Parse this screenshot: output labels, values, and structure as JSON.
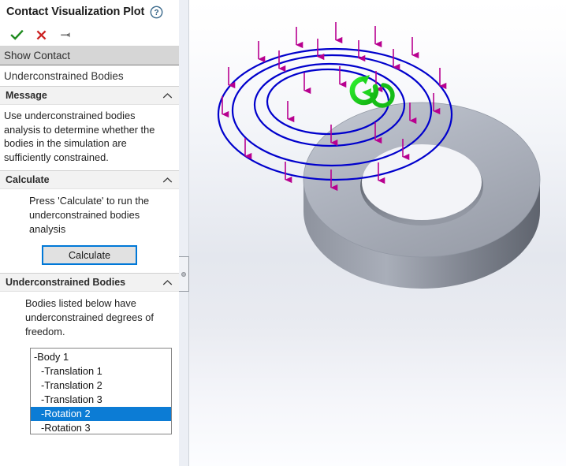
{
  "panel": {
    "title": "Contact Visualization Plot",
    "help_icon": "question-mark-circle-icon",
    "toolbar": {
      "accept_label": "✓",
      "accept_icon": "check-icon",
      "cancel_label": "✕",
      "cancel_icon": "x-icon",
      "pin_label": "⚑",
      "pin_icon": "pushpin-icon"
    },
    "modes": [
      {
        "label": "Show Contact",
        "selected": true
      },
      {
        "label": "Underconstrained Bodies",
        "selected": false
      }
    ],
    "sections": [
      {
        "id": "message",
        "title": "Message",
        "collapse_icon": "chevron-up-icon",
        "text": "Use underconstrained bodies analysis to determine whether the bodies in the simulation are sufficiently constrained."
      },
      {
        "id": "calculate",
        "title": "Calculate",
        "collapse_icon": "chevron-up-icon",
        "hint": "Press 'Calculate' to run the underconstrained bodies analysis",
        "button_label": "Calculate"
      },
      {
        "id": "underconstrained_bodies",
        "title": "Underconstrained Bodies",
        "collapse_icon": "chevron-up-icon",
        "hint": "Bodies listed below have underconstrained degrees of freedom."
      }
    ],
    "dof_list": [
      {
        "label": "-Body 1",
        "level": 0,
        "selected": false
      },
      {
        "label": "-Translation 1",
        "level": 1,
        "selected": false
      },
      {
        "label": "-Translation 2",
        "level": 1,
        "selected": false
      },
      {
        "label": "-Translation 3",
        "level": 1,
        "selected": false
      },
      {
        "label": "-Rotation 2",
        "level": 1,
        "selected": true
      },
      {
        "label": "-Rotation 3",
        "level": 1,
        "selected": false
      }
    ]
  },
  "splitter": {
    "name": "panel-splitter",
    "grip_icon": "splitter-grip-dot-icon"
  },
  "viewport": {
    "name": "3d-graphics-viewport",
    "model_name": "washer-body",
    "annotations": {
      "contact_rings_icon": "blue-ellipse-contour-rings",
      "force_arrows_icon": "magenta-down-arrows",
      "rotation_indicator_icon": "green-rotation-arrow"
    }
  },
  "colors": {
    "accent_blue": "#0078d7",
    "selection_blue": "#0c7cd5",
    "contour_blue": "#0000cc",
    "arrow_magenta": "#b8008f",
    "rotation_green": "#14d414",
    "body_gray": "#a8adb8",
    "check_green": "#1f8b1f",
    "cancel_red": "#cc2222",
    "pin_gray": "#707070"
  }
}
